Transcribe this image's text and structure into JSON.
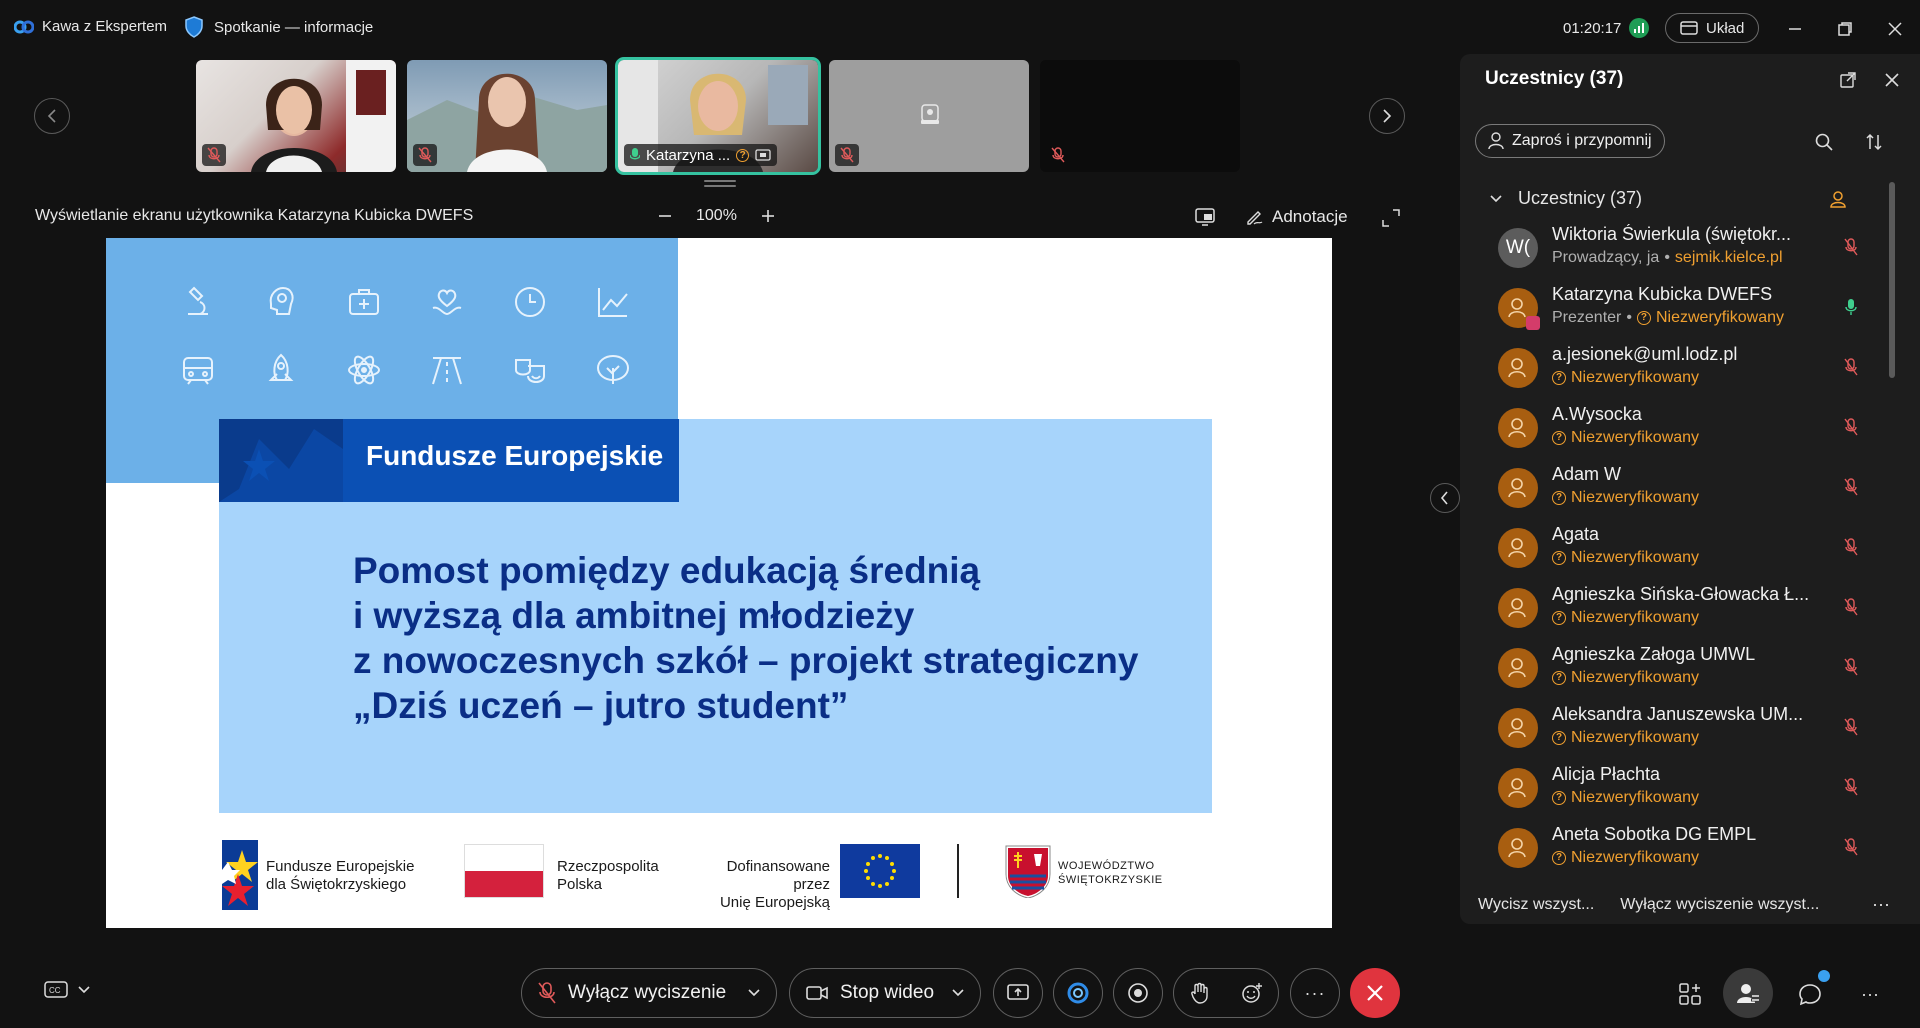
{
  "titlebar": {
    "app_name": "Kawa z Ekspertem",
    "meeting_info": "Spotkanie — informacje",
    "timer": "01:20:17",
    "layout_label": "Układ"
  },
  "thumbnails": [
    {
      "name": "",
      "muted": true,
      "active": false
    },
    {
      "name": "",
      "muted": true,
      "active": false
    },
    {
      "name": "Katarzyna ...",
      "muted": false,
      "active": true
    },
    {
      "name": "",
      "muted": true,
      "active": false
    },
    {
      "name": "",
      "muted": true,
      "active": false
    }
  ],
  "share": {
    "title": "Wyświetlanie ekranu użytkownika Katarzyna Kubicka DWEFS",
    "zoom": "100%",
    "annotate_label": "Adnotacje"
  },
  "slide": {
    "brand": "Fundusze Europejskie",
    "headline": [
      "Pomost pomiędzy edukacją średnią",
      "i wyższą dla ambitnej młodzieży",
      "z nowoczesnych szkół – projekt strategiczny",
      "„Dziś uczeń – jutro student”"
    ],
    "logos": {
      "fe_line1": "Fundusze Europejskie",
      "fe_line2": "dla Świętokrzyskiego",
      "rp_line1": "Rzeczpospolita",
      "rp_line2": "Polska",
      "ue_line1": "Dofinansowane przez",
      "ue_line2": "Unię Europejską",
      "woj_line1": "WOJEWÓDZTWO",
      "woj_line2": "ŚWIĘTOKRZYSKIE"
    },
    "colors": {
      "top_block": "#6cb0e8",
      "panel": "#a7d4fb",
      "fe_bar": "#0b50b4",
      "headline": "#0a2e86"
    }
  },
  "participants_panel": {
    "title": "Uczestnicy (37)",
    "invite_label": "Zaproś i przypomnij",
    "group_label": "Uczestnicy (37)",
    "participants": [
      {
        "name": "Wiktoria Świerkula (świętokr...",
        "initials": "W(",
        "role": "Prowadzący, ja",
        "org": "sejmik.kielce.pl",
        "status": "",
        "mic": "muted"
      },
      {
        "name": "Katarzyna Kubicka DWEFS",
        "initials": "",
        "role": "Prezenter",
        "org": "",
        "status": "Niezweryfikowany",
        "mic": "active"
      },
      {
        "name": "a.jesionek@uml.lodz.pl",
        "initials": "",
        "role": "",
        "org": "",
        "status": "Niezweryfikowany",
        "mic": "muted"
      },
      {
        "name": "A.Wysocka",
        "initials": "",
        "role": "",
        "org": "",
        "status": "Niezweryfikowany",
        "mic": "muted"
      },
      {
        "name": "Adam W",
        "initials": "",
        "role": "",
        "org": "",
        "status": "Niezweryfikowany",
        "mic": "muted"
      },
      {
        "name": "Agata",
        "initials": "",
        "role": "",
        "org": "",
        "status": "Niezweryfikowany",
        "mic": "muted"
      },
      {
        "name": "Agnieszka Sińska-Głowacka Ł...",
        "initials": "",
        "role": "",
        "org": "",
        "status": "Niezweryfikowany",
        "mic": "muted"
      },
      {
        "name": "Agnieszka Załoga UMWL",
        "initials": "",
        "role": "",
        "org": "",
        "status": "Niezweryfikowany",
        "mic": "muted"
      },
      {
        "name": "Aleksandra Januszewska UM...",
        "initials": "",
        "role": "",
        "org": "",
        "status": "Niezweryfikowany",
        "mic": "muted"
      },
      {
        "name": "Alicja Płachta",
        "initials": "",
        "role": "",
        "org": "",
        "status": "Niezweryfikowany",
        "mic": "muted"
      },
      {
        "name": "Aneta Sobotka DG EMPL",
        "initials": "",
        "role": "",
        "org": "",
        "status": "Niezweryfikowany",
        "mic": "muted"
      }
    ],
    "footer_mute_all": "Wycisz wszyst...",
    "footer_unmute_all": "Wyłącz wyciszenie wszyst..."
  },
  "bottom_bar": {
    "unmute_label": "Wyłącz wyciszenie",
    "video_label": "Stop wideo"
  }
}
